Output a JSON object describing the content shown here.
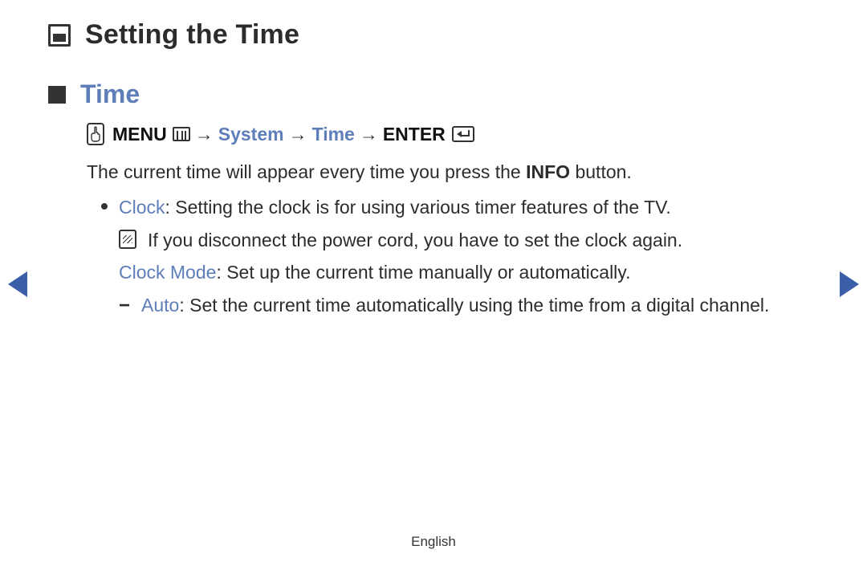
{
  "title": "Setting the Time",
  "section_heading": "Time",
  "breadcrumb": {
    "menu": "MENU",
    "arrow": "→",
    "path1": "System",
    "path2": "Time",
    "enter": "ENTER"
  },
  "intro": {
    "pre": "The current time will appear every time you press the ",
    "bold": "INFO",
    "post": " button."
  },
  "clock": {
    "term": "Clock",
    "text": ": Setting the clock is for using various timer features of the TV."
  },
  "note": "If you disconnect the power cord, you have to set the clock again.",
  "clock_mode": {
    "term": "Clock Mode",
    "text": ": Set up the current time manually or automatically."
  },
  "auto": {
    "dash": "−",
    "term": "Auto",
    "text": ": Set the current time automatically using the time from a digital channel."
  },
  "footer": "English"
}
